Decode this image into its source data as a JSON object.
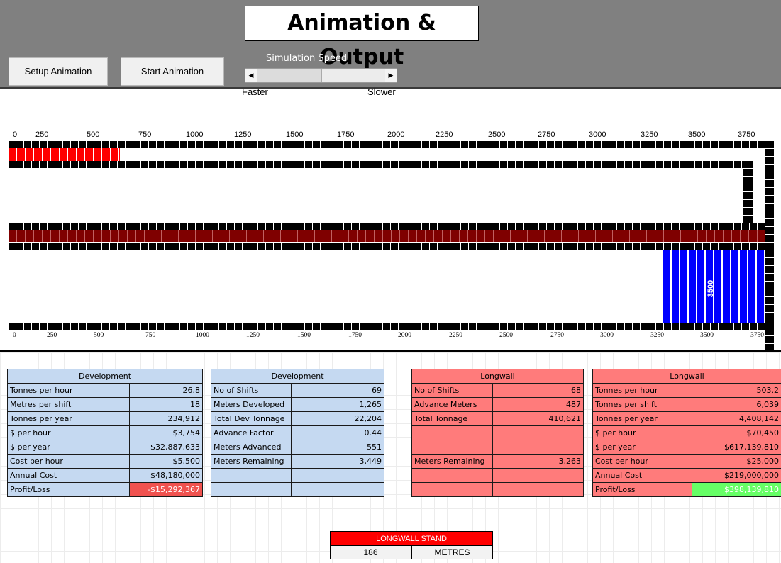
{
  "header": {
    "title": "Animation & Output",
    "setup_button": "Setup Animation",
    "start_button": "Start Animation",
    "speed_label": "Simulation Speed",
    "faster_label": "Faster",
    "slower_label": "Slower"
  },
  "axis_top": [
    "0",
    "250",
    "500",
    "750",
    "1000",
    "1250",
    "1500",
    "1750",
    "2000",
    "2250",
    "2500",
    "2750",
    "3000",
    "3250",
    "3500",
    "3750"
  ],
  "axis_bottom": [
    "0",
    "250",
    "500",
    "750",
    "1000",
    "1250",
    "1500",
    "1750",
    "2000",
    "2250",
    "2500",
    "2750",
    "3000",
    "3250",
    "3500",
    "3750"
  ],
  "animation": {
    "development_progress_metres": 551,
    "gateroad_span_metres": 3750,
    "longwall_block_label": "3500",
    "colors": {
      "development": "#ff0000",
      "gateroad": "#7f0000",
      "longwall": "#0000ff",
      "roadway": "#000000"
    }
  },
  "dev_table_1": {
    "header": "Development",
    "rows": [
      {
        "label": "Tonnes per hour",
        "value": "26.8"
      },
      {
        "label": "Metres per shift",
        "value": "18"
      },
      {
        "label": "Tonnes per year",
        "value": "234,912"
      },
      {
        "label": "$ per hour",
        "value": "$3,754"
      },
      {
        "label": "$ per year",
        "value": "$32,887,633"
      },
      {
        "label": "Cost per hour",
        "value": "$5,500"
      },
      {
        "label": "Annual Cost",
        "value": "$48,180,000"
      },
      {
        "label": "Profit/Loss",
        "value": "-$15,292,367"
      }
    ]
  },
  "dev_table_2": {
    "header": "Development",
    "rows": [
      {
        "label": "No of Shifts",
        "value": "69"
      },
      {
        "label": "Meters Developed",
        "value": "1,265"
      },
      {
        "label": "Total Dev Tonnage",
        "value": "22,204"
      },
      {
        "label": "Advance Factor",
        "value": "0.44"
      },
      {
        "label": "Meters Advanced",
        "value": "551"
      },
      {
        "label": "Meters Remaining",
        "value": "3,449"
      },
      {
        "label": "",
        "value": ""
      },
      {
        "label": "",
        "value": ""
      }
    ]
  },
  "lw_table_1": {
    "header": "Longwall",
    "rows": [
      {
        "label": "No of Shifts",
        "value": "68"
      },
      {
        "label": "Advance Meters",
        "value": "487"
      },
      {
        "label": "Total Tonnage",
        "value": "410,621"
      },
      {
        "label": "",
        "value": ""
      },
      {
        "label": "",
        "value": ""
      },
      {
        "label": "Meters Remaining",
        "value": "3,263"
      },
      {
        "label": "",
        "value": ""
      },
      {
        "label": "",
        "value": ""
      }
    ]
  },
  "lw_table_2": {
    "header": "Longwall",
    "rows": [
      {
        "label": "Tonnes per hour",
        "value": "503.2"
      },
      {
        "label": "Tonnes per shift",
        "value": "6,039"
      },
      {
        "label": "Tonnes per year",
        "value": "4,408,142"
      },
      {
        "label": "$ per hour",
        "value": "$70,450"
      },
      {
        "label": "$ per year",
        "value": "$617,139,810"
      },
      {
        "label": "Cost per hour",
        "value": "$25,000"
      },
      {
        "label": "Annual Cost",
        "value": "$219,000,000"
      },
      {
        "label": "Profit/Loss",
        "value": "$398,139,810"
      }
    ]
  },
  "longwall_stand": {
    "title": "LONGWALL STAND",
    "value": "186",
    "unit": "METRES"
  }
}
